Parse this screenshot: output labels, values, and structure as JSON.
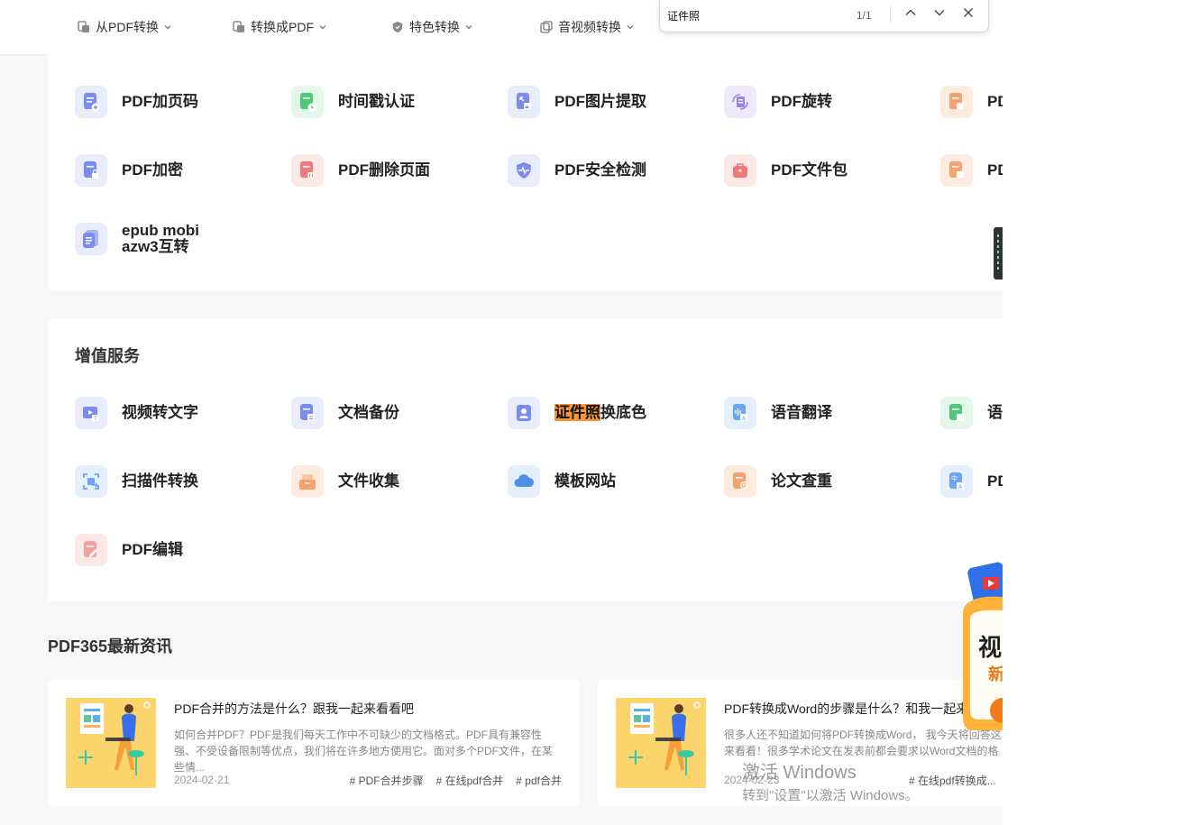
{
  "nav": {
    "items": [
      {
        "label": "从PDF转换"
      },
      {
        "label": "转换成PDF"
      },
      {
        "label": "特色转换"
      },
      {
        "label": "音视频转换"
      }
    ]
  },
  "find_bar": {
    "query": "证件照",
    "count": "1/1"
  },
  "tools_section": {
    "items": [
      {
        "label": "PDF加页码",
        "color": "#e9ecfb"
      },
      {
        "label": "时间戳认证",
        "color": "#e4f7ea"
      },
      {
        "label": "PDF图片提取",
        "color": "#e9ecfb"
      },
      {
        "label": "PDF旋转",
        "color": "#efeafb"
      },
      {
        "label": "PD",
        "color": "#fdebe0"
      },
      {
        "label": "PDF加密",
        "color": "#e9ecfb"
      },
      {
        "label": "PDF删除页面",
        "color": "#fde8e8"
      },
      {
        "label": "PDF安全检测",
        "color": "#e9ecfb"
      },
      {
        "label": "PDF文件包",
        "color": "#fde8e8"
      },
      {
        "label": "PD",
        "color": "#fdebe0"
      },
      {
        "label_line1": "epub mobi",
        "label_line2": "azw3互转",
        "color": "#e9ecfb"
      }
    ]
  },
  "value_added": {
    "title": "增值服务",
    "items": [
      {
        "label": "视频转文字",
        "color": "#e9ecfb"
      },
      {
        "label": "文档备份",
        "color": "#e9ecfb"
      },
      {
        "label_highlight": "证件照",
        "label_rest": "换底色",
        "color": "#e9ecfb"
      },
      {
        "label": "语音翻译",
        "color": "#e6f0fc"
      },
      {
        "label": "语",
        "color": "#e4f7ea"
      },
      {
        "label": "扫描件转换",
        "color": "#e6f0fc"
      },
      {
        "label": "文件收集",
        "color": "#fdebe0"
      },
      {
        "label": "模板网站",
        "color": "#e6f0fc"
      },
      {
        "label": "论文查重",
        "color": "#fdebe0"
      },
      {
        "label": "PD",
        "color": "#e6f0fc"
      },
      {
        "label": "PDF编辑",
        "color": "#fde8e8"
      }
    ]
  },
  "news": {
    "title": "PDF365最新资讯",
    "articles": [
      {
        "title": "PDF合并的方法是什么？跟我一起来看看吧",
        "desc": "如何合并PDF？PDF是我们每天工作中不可缺少的文档格式。PDF具有兼容性强、不受设备限制等优点，我们将在许多地方使用它。面对多个PDF文件，在某些情...",
        "date": "2024-02-21",
        "tags": [
          "# PDF合并步骤",
          "# 在线pdf合并",
          "# pdf合并"
        ]
      },
      {
        "title": "PDF转换成Word的步骤是什么？和我一起来",
        "desc": "很多人还不知道如何将PDF转换成Word， 我今天将回答这来看看！很多学术论文在发表前都会要求以Word文档的格",
        "date": "2024-02-23",
        "tags": [
          "# 在线pdf转换成..."
        ]
      }
    ]
  },
  "promo": {
    "text1": "视",
    "text2": "新"
  },
  "watermark": {
    "line1": "激活 Windows",
    "line2": "转到\"设置\"以激活 Windows。"
  }
}
